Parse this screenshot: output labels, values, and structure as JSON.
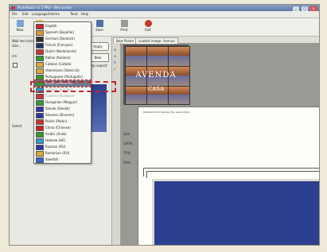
{
  "window": {
    "title": "PosteRazor v1.5 PRO - New poster",
    "controls": [
      "_",
      "□",
      "×"
    ]
  },
  "menu": [
    "File",
    "Edit",
    "Language/Idioma",
    "Tools",
    "Help"
  ],
  "toolbar": {
    "buttons": [
      {
        "label": "New",
        "icon": "new-icon"
      },
      {
        "label": "Open",
        "icon": "open-icon"
      },
      {
        "label": "Save",
        "icon": "save-icon"
      },
      {
        "label": "Print",
        "icon": "print-icon"
      },
      {
        "label": "Exit",
        "icon": "exit-icon"
      }
    ]
  },
  "left_panel": {
    "line1": "Wait we trans",
    "line2": "size...",
    "apply_label": "Apply",
    "unit_label": "cm",
    "new_label": "New",
    "keep_aspect_label": "Keep aspect",
    "select_label": "Select"
  },
  "languages": [
    {
      "name": "English",
      "flag": "#c23"
    },
    {
      "name": "Spanish (Español)",
      "flag": "#d93"
    },
    {
      "name": "German (Deutsch)",
      "flag": "#333"
    },
    {
      "name": "French (Français)",
      "flag": "#236"
    },
    {
      "name": "Dutch (Nederlands)",
      "flag": "#c33"
    },
    {
      "name": "Italian (Italiano)",
      "flag": "#393"
    },
    {
      "name": "Catalan (Català)",
      "flag": "#da3"
    },
    {
      "name": "Valenciano (Valencià)",
      "flag": "#da3"
    },
    {
      "name": "Portuguese (Português)",
      "flag": "#393"
    },
    {
      "name": "Brazil (Brasileiro)",
      "flag": "#393"
    },
    {
      "name": "Galician (Galego)",
      "flag": "#39c"
    },
    {
      "name": "Euskera (Euskara)",
      "flag": "#c33"
    },
    {
      "name": "Hungarian (Magyar)",
      "flag": "#393"
    },
    {
      "name": "Slovak (Slovák)",
      "flag": "#33a"
    },
    {
      "name": "Slovene (Slovene)",
      "flag": "#33a"
    },
    {
      "name": "Polish (Polski)",
      "flag": "#c33"
    },
    {
      "name": "China (Chinese)",
      "flag": "#c22"
    },
    {
      "name": "Arabic (Arab)",
      "flag": "#393"
    },
    {
      "name": "Hebrew (HE)",
      "flag": "#39c"
    },
    {
      "name": "Russian (RU)",
      "flag": "#33a"
    },
    {
      "name": "Romanian (RO)",
      "flag": "#da3"
    },
    {
      "name": "Swedish",
      "flag": "#36c"
    }
  ],
  "selected_language_index": 9,
  "tabs": [
    "New Poster",
    "Loaded image: Avenue"
  ],
  "poster_text": {
    "big": "AVENDA",
    "small": "CASA"
  },
  "page_header": "Posterazor Pro Sample fig: see printers",
  "percentages": [
    "Size",
    "100%",
    "75%",
    "50%"
  ],
  "colors": {
    "accent": "#c0262a",
    "poster_blue": "#2d3f8f"
  }
}
